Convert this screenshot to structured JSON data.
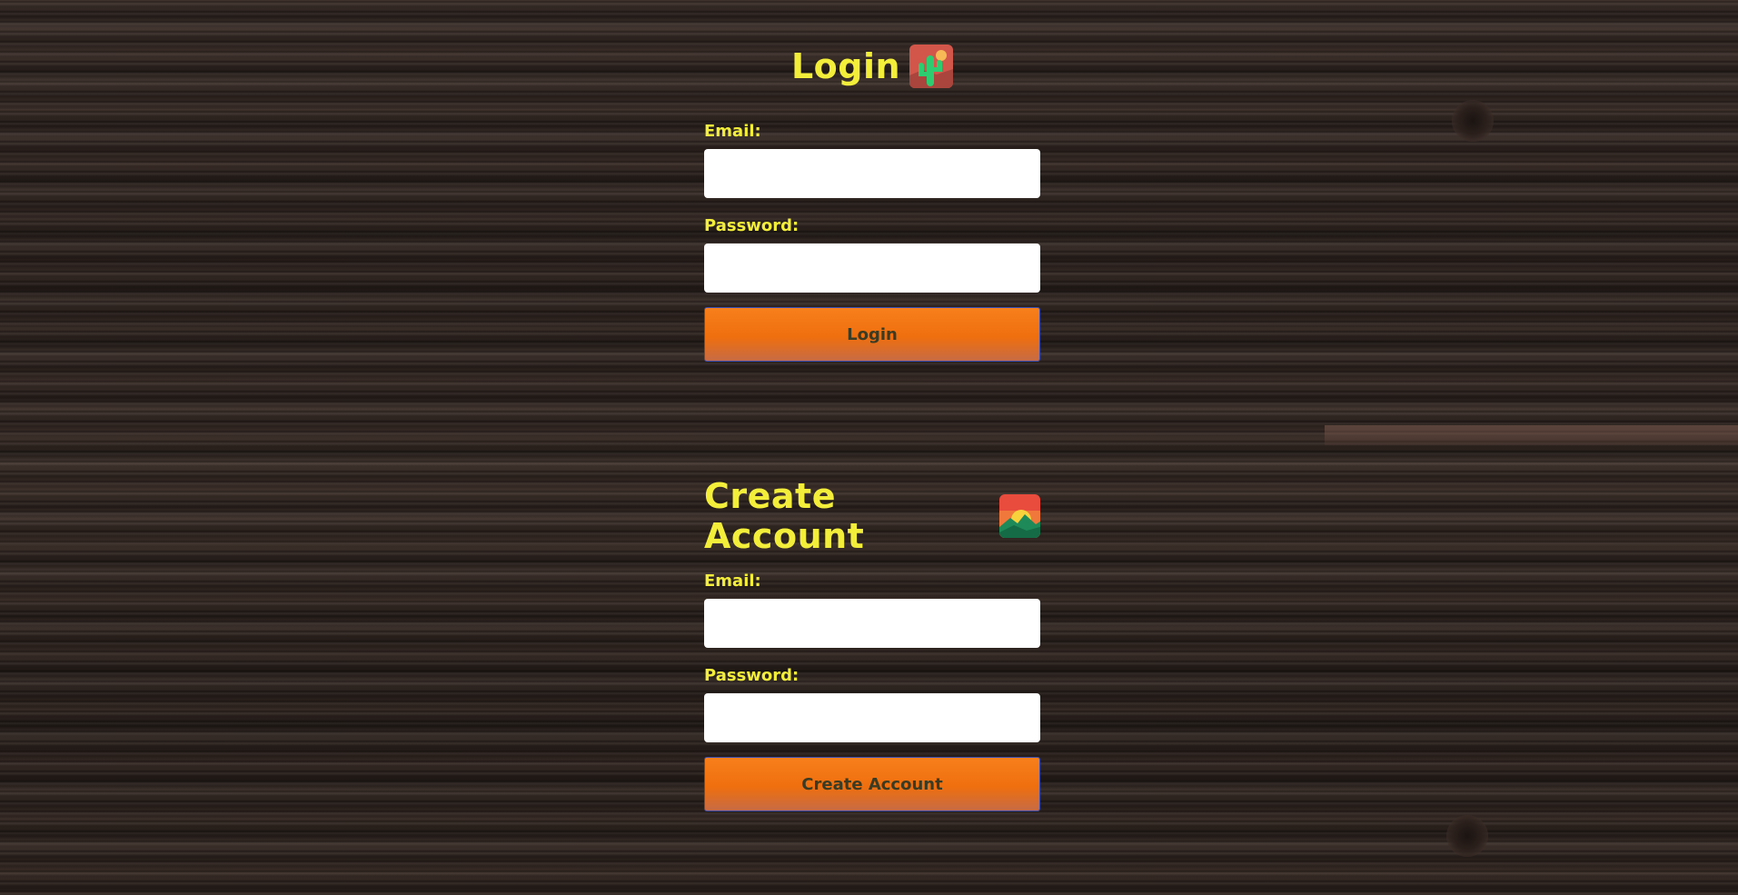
{
  "login": {
    "title": "Login",
    "icon": "desert-cactus-icon",
    "email_label": "Email:",
    "email_value": "",
    "password_label": "Password:",
    "password_value": "",
    "submit_label": "Login"
  },
  "create_account": {
    "title": "Create Account",
    "icon": "sunrise-over-mountains-icon",
    "email_label": "Email:",
    "email_value": "",
    "password_label": "Password:",
    "password_value": "",
    "submit_label": "Create Account"
  },
  "colors": {
    "label_text": "#f3ee3a",
    "button_orange": "#f77f1c",
    "button_border": "#3d4fb0",
    "button_text": "#3b3a22",
    "input_background": "#ffffff",
    "background": "dark-wood-texture"
  }
}
